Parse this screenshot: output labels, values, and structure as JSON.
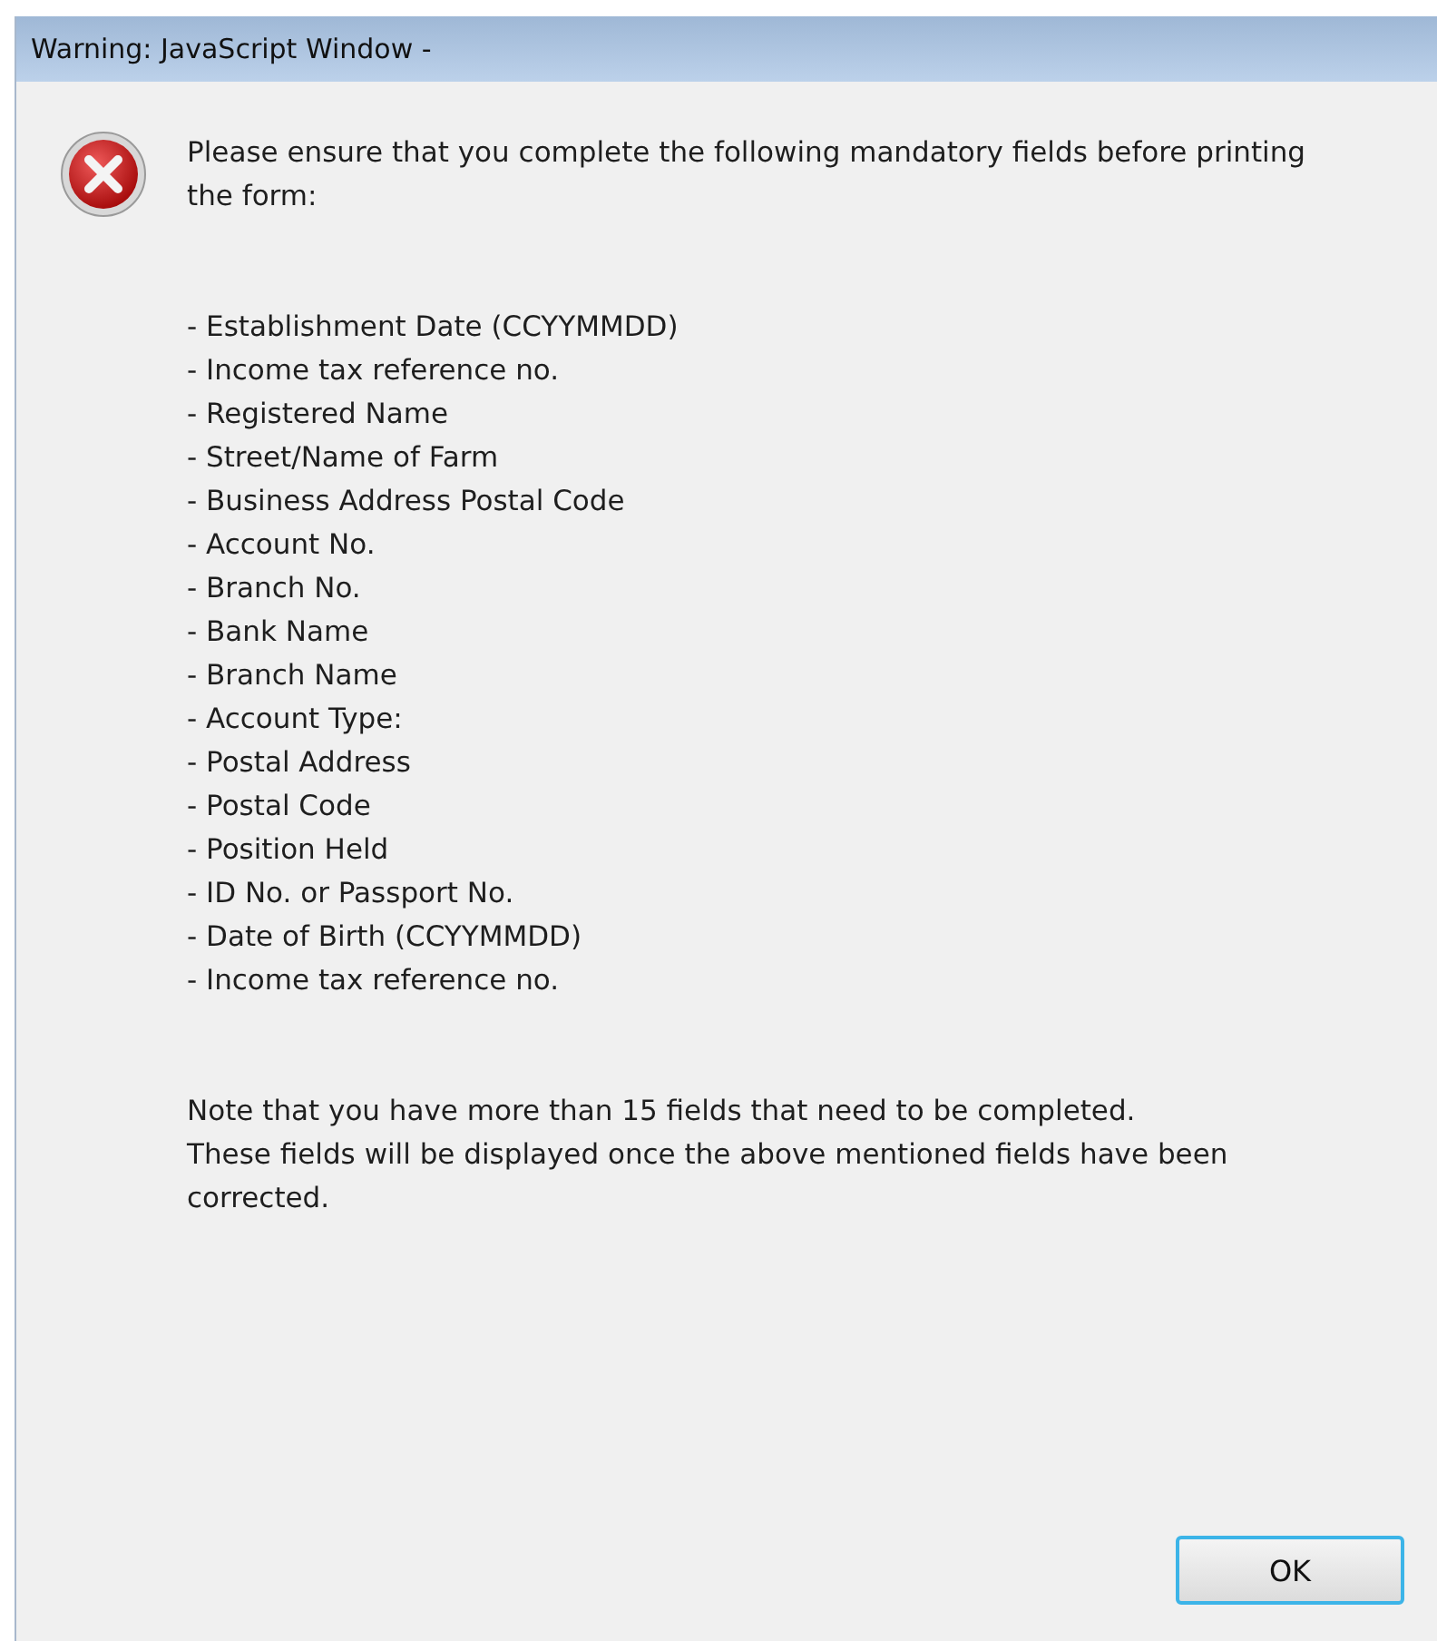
{
  "window": {
    "title": "Warning: JavaScript Window -"
  },
  "dialog": {
    "message": "Please ensure that you complete the following mandatory fields before printing the form:",
    "fields": [
      "- Establishment Date (CCYYMMDD)",
      "- Income tax reference no.",
      "- Registered Name",
      "- Street/Name of Farm",
      "- Business Address Postal Code",
      "- Account No.",
      "- Branch No.",
      "- Bank Name",
      "- Branch Name",
      "- Account Type:",
      "- Postal Address",
      "- Postal Code",
      "- Position Held",
      "- ID No. or Passport No.",
      "- Date of Birth (CCYYMMDD)",
      "- Income tax reference no."
    ],
    "note": [
      "Note that you have more than 15 fields that need to be completed.",
      "These fields will be displayed once the above mentioned fields have been corrected."
    ]
  },
  "buttons": [
    "OK"
  ]
}
